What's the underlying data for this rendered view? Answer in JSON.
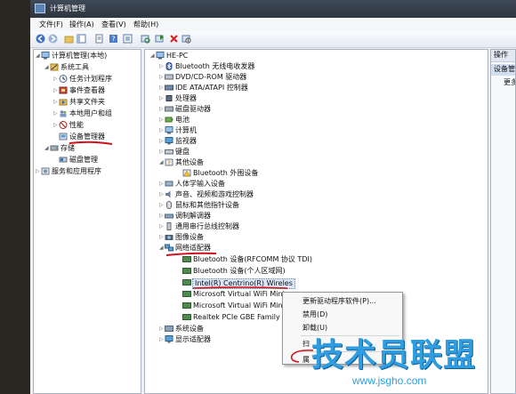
{
  "window": {
    "title": "计算机管理"
  },
  "menubar": [
    "文件(F)",
    "操作(A)",
    "查看(V)",
    "帮助(H)"
  ],
  "left_tree": [
    {
      "label": "计算机管理(本地)",
      "level": 0,
      "expanded": true,
      "icon": "computer-icon"
    },
    {
      "label": "系统工具",
      "level": 1,
      "expanded": true,
      "icon": "tools-icon"
    },
    {
      "label": "任务计划程序",
      "level": 2,
      "expanded": false,
      "icon": "task-scheduler-icon"
    },
    {
      "label": "事件查看器",
      "level": 2,
      "expanded": false,
      "icon": "event-viewer-icon"
    },
    {
      "label": "共享文件夹",
      "level": 2,
      "expanded": false,
      "icon": "shared-folder-icon"
    },
    {
      "label": "本地用户和组",
      "level": 2,
      "expanded": false,
      "icon": "users-icon"
    },
    {
      "label": "性能",
      "level": 2,
      "expanded": false,
      "icon": "performance-icon"
    },
    {
      "label": "设备管理器",
      "level": 2,
      "expanded": null,
      "icon": "device-manager-icon"
    },
    {
      "label": "存储",
      "level": 1,
      "expanded": true,
      "icon": "storage-icon"
    },
    {
      "label": "磁盘管理",
      "level": 2,
      "expanded": null,
      "icon": "disk-icon"
    },
    {
      "label": "服务和应用程序",
      "level": 1,
      "expanded": false,
      "icon": "services-icon"
    }
  ],
  "device_tree": {
    "root": "HE-PC",
    "categories": [
      {
        "label": "Bluetooth 无线电收发器",
        "expanded": false,
        "icon": "bluetooth-icon"
      },
      {
        "label": "DVD/CD-ROM 驱动器",
        "expanded": false,
        "icon": "dvd-icon"
      },
      {
        "label": "IDE ATA/ATAPI 控制器",
        "expanded": false,
        "icon": "ide-icon"
      },
      {
        "label": "处理器",
        "expanded": false,
        "icon": "processor-icon"
      },
      {
        "label": "磁盘驱动器",
        "expanded": false,
        "icon": "disk-drive-icon"
      },
      {
        "label": "电池",
        "expanded": false,
        "icon": "battery-icon"
      },
      {
        "label": "计算机",
        "expanded": false,
        "icon": "computer-icon"
      },
      {
        "label": "监视器",
        "expanded": false,
        "icon": "monitor-icon"
      },
      {
        "label": "键盘",
        "expanded": false,
        "icon": "keyboard-icon"
      },
      {
        "label": "其他设备",
        "expanded": true,
        "icon": "other-devices-icon",
        "children": [
          {
            "label": "Bluetooth 外围设备",
            "icon": "unknown-device-icon"
          }
        ]
      },
      {
        "label": "人体学输入设备",
        "expanded": false,
        "icon": "hid-icon"
      },
      {
        "label": "声音、视频和游戏控制器",
        "expanded": false,
        "icon": "sound-icon"
      },
      {
        "label": "鼠标和其他指针设备",
        "expanded": false,
        "icon": "mouse-icon"
      },
      {
        "label": "调制解调器",
        "expanded": false,
        "icon": "modem-icon"
      },
      {
        "label": "通用串行总线控制器",
        "expanded": false,
        "icon": "usb-icon"
      },
      {
        "label": "图像设备",
        "expanded": false,
        "icon": "camera-icon"
      },
      {
        "label": "网络适配器",
        "expanded": true,
        "icon": "network-adapter-icon",
        "children": [
          {
            "label": "Bluetooth 设备(RFCOMM 协议 TDI)",
            "icon": "network-card-icon"
          },
          {
            "label": "Bluetooth 设备(个人区域网)",
            "icon": "network-card-icon"
          },
          {
            "label": "Intel(R) Centrino(R) Wireles",
            "icon": "network-card-icon",
            "selected": true
          },
          {
            "label": "Microsoft Virtual WiFi Minip",
            "icon": "network-card-icon"
          },
          {
            "label": "Microsoft Virtual WiFi Minip",
            "icon": "network-card-icon"
          },
          {
            "label": "Realtek PCIe GBE Family Co",
            "icon": "network-card-icon"
          }
        ]
      },
      {
        "label": "系统设备",
        "expanded": false,
        "icon": "system-devices-icon"
      },
      {
        "label": "显示适配器",
        "expanded": false,
        "icon": "display-adapter-icon"
      }
    ]
  },
  "context_menu": {
    "items": [
      "更新驱动程序软件(P)...",
      "禁用(D)",
      "卸载(U)",
      "扫",
      "属"
    ]
  },
  "actions_pane": {
    "header": "操作",
    "section": "设备管理",
    "more": "更多"
  },
  "watermark": {
    "text": "技术员联盟",
    "url": "www.jsgho.com"
  },
  "colors": {
    "accent": "#3399ff",
    "annotation": "#d0101a",
    "watermark": "#2f9de0"
  }
}
